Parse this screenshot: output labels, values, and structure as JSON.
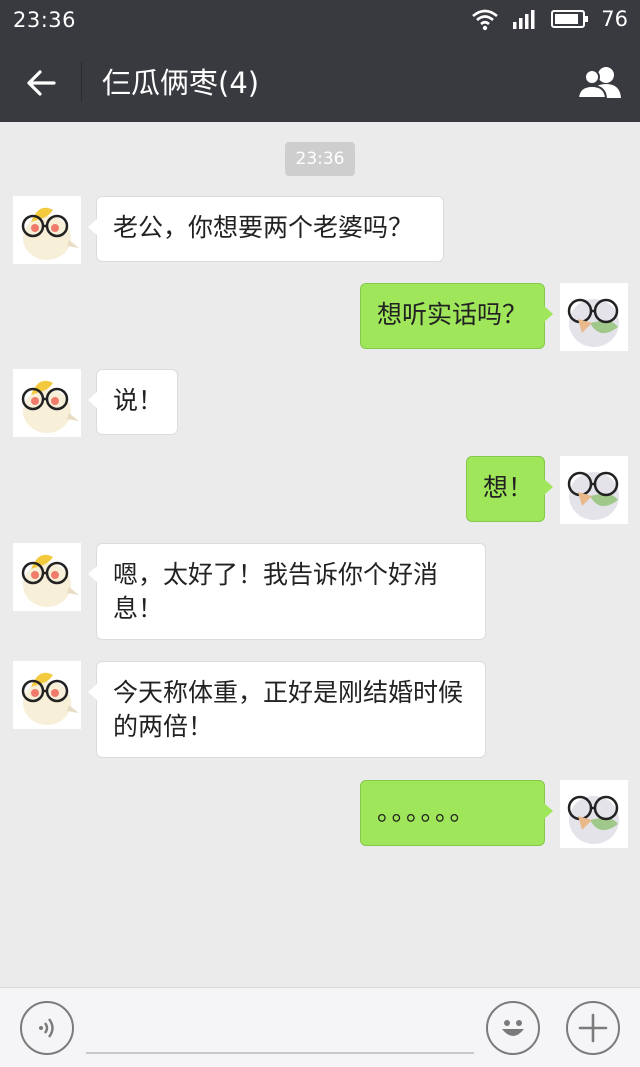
{
  "status_bar": {
    "time": "23:36",
    "battery": "76"
  },
  "header": {
    "title": "仨瓜俩枣(4)"
  },
  "chat": {
    "timestamp": "23:36",
    "messages": [
      {
        "side": "left",
        "text": "老公，你想要两个老婆吗？"
      },
      {
        "side": "right",
        "text": "想听实话吗？"
      },
      {
        "side": "left",
        "text": "说！"
      },
      {
        "side": "right",
        "text": "想！"
      },
      {
        "side": "left",
        "text": "嗯，太好了！我告诉你个好消息！"
      },
      {
        "side": "left",
        "text": "今天称体重，正好是刚结婚时候的两倍！"
      },
      {
        "side": "right",
        "text": "。。。。。。"
      }
    ]
  },
  "input": {
    "value": ""
  },
  "colors": {
    "header": "#393a3f",
    "chat_bg": "#ebebeb",
    "my_bubble": "#9fe65a",
    "other_bubble": "#ffffff"
  }
}
